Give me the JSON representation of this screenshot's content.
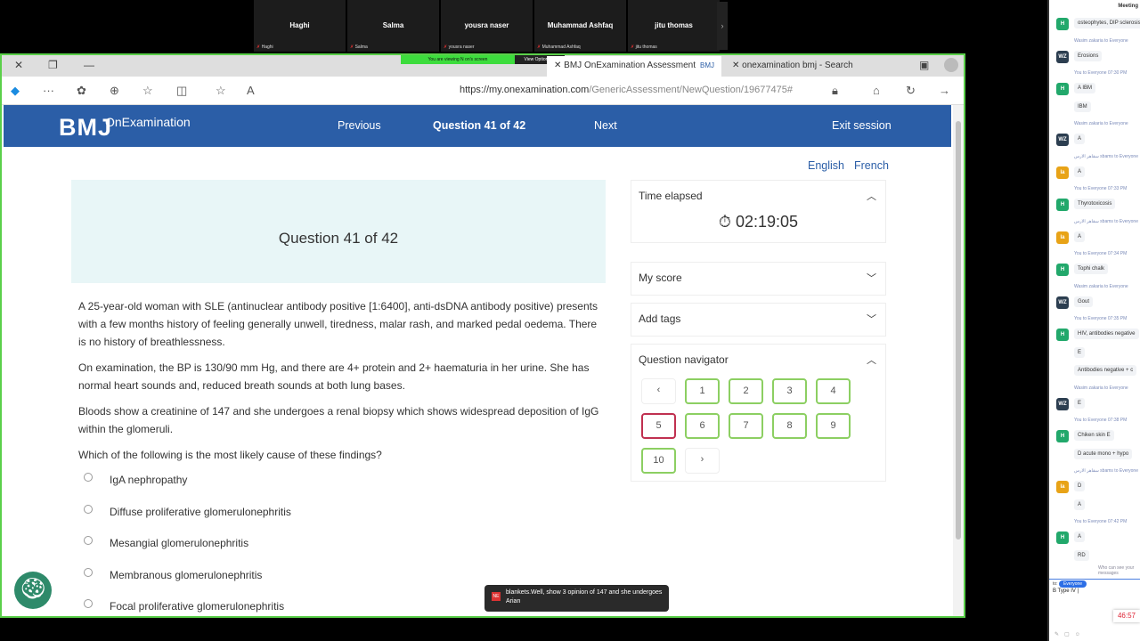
{
  "meeting": {
    "participants": [
      {
        "name": "Haghi",
        "label": "Haghi"
      },
      {
        "name": "Salma",
        "label": "Salma"
      },
      {
        "name": "yousra naser",
        "label": "yousra naser"
      },
      {
        "name": "Muhammad Ashfaq",
        "label": "Muhammad Ashfaq"
      },
      {
        "name": "jitu thomas",
        "label": "jitu thomas"
      }
    ],
    "viewing_banner": "You are viewing N on's screen",
    "view_options": "View Options ⌄"
  },
  "browser": {
    "tabs": [
      {
        "label": "BMJ OnExamination Assessment",
        "badge": "BMJ"
      },
      {
        "label": "onexamination bmj - Search"
      }
    ],
    "url_host": "https://my.onexamination.com",
    "url_path": "/GenericAssessment/NewQuestion/19677475#"
  },
  "header": {
    "logo": "BMJ",
    "product": "OnExamination",
    "previous": "Previous",
    "question_counter": "Question 41 of 42",
    "next": "Next",
    "exit": "Exit session"
  },
  "languages": [
    "English",
    "French"
  ],
  "question": {
    "title": "Question 41 of 42",
    "paragraphs": [
      "A 25-year-old woman with SLE (antinuclear antibody positive [1:6400], anti-dsDNA antibody positive) presents with a few months history of feeling generally unwell, tiredness, malar rash, and marked pedal oedema. There is no history of breathlessness.",
      "On examination, the BP is 130/90 mm Hg, and there are 4+ protein and 2+ haematuria in her urine. She has normal heart sounds and, reduced breath sounds at both lung bases.",
      "Bloods show a creatinine of 147 and she undergoes a renal biopsy which shows widespread deposition of IgG within the glomeruli.",
      "Which of the following is the most likely cause of these findings?"
    ],
    "options": [
      "IgA nephropathy",
      "Diffuse proliferative glomerulonephritis",
      "Mesangial glomerulonephritis",
      "Membranous glomerulonephritis",
      "Focal proliferative glomerulonephritis"
    ]
  },
  "sidebar": {
    "time_label": "Time elapsed",
    "time_value": "02:19:05",
    "score_label": "My score",
    "tags_label": "Add tags",
    "navigator_label": "Question navigator",
    "nav_prev": "‹",
    "nav_next": "›",
    "nav_items": [
      {
        "n": "1",
        "status": "answered"
      },
      {
        "n": "2",
        "status": "answered"
      },
      {
        "n": "3",
        "status": "answered"
      },
      {
        "n": "4",
        "status": "answered"
      },
      {
        "n": "5",
        "status": "incorrect"
      },
      {
        "n": "6",
        "status": "answered"
      },
      {
        "n": "7",
        "status": "answered"
      },
      {
        "n": "8",
        "status": "answered"
      },
      {
        "n": "9",
        "status": "answered"
      },
      {
        "n": "10",
        "status": "answered"
      }
    ]
  },
  "colors": {
    "brand": "#2b5ea7",
    "answered": "#8ccf62",
    "incorrect": "#c03050",
    "question_bg": "#e8f6f7"
  },
  "caption": {
    "avatar": "NE",
    "text": "blankets.Well, show 3 opinion of 147 and she undergoes Arian"
  },
  "chat": {
    "title": "Meeting",
    "items": [
      {
        "t": "msg",
        "av": "H",
        "c": "#22a86b",
        "text": "osteophytes, DIP sclerosis"
      },
      {
        "t": "meta",
        "text": "Wasim zakaria to Everyone"
      },
      {
        "t": "msg",
        "av": "WZ",
        "c": "#2c3e50",
        "text": "Erosions"
      },
      {
        "t": "meta",
        "text": "You to Everyone 07:30 PM"
      },
      {
        "t": "msg",
        "av": "H",
        "c": "#22a86b",
        "text": "A  IBM"
      },
      {
        "t": "bub",
        "text": "IBM"
      },
      {
        "t": "meta",
        "text": "Wasim zakaria to Everyone"
      },
      {
        "t": "msg",
        "av": "WZ",
        "c": "#2c3e50",
        "text": "A"
      },
      {
        "t": "meta",
        "text": "سقاهر الارس sbams to Everyone"
      },
      {
        "t": "msg",
        "av": "la",
        "c": "#e8a317",
        "text": "A"
      },
      {
        "t": "meta",
        "text": "You to Everyone 07:33 PM"
      },
      {
        "t": "msg",
        "av": "H",
        "c": "#22a86b",
        "text": "Thyrotoxicosis"
      },
      {
        "t": "meta",
        "text": "سقاهر الارس sbams to Everyone"
      },
      {
        "t": "msg",
        "av": "la",
        "c": "#e8a317",
        "text": "A"
      },
      {
        "t": "meta",
        "text": "You to Everyone 07:34 PM"
      },
      {
        "t": "msg",
        "av": "H",
        "c": "#22a86b",
        "text": "Tophi chalk"
      },
      {
        "t": "meta",
        "text": "Wasim zakaria to Everyone"
      },
      {
        "t": "msg",
        "av": "WZ",
        "c": "#2c3e50",
        "text": "Gout"
      },
      {
        "t": "meta",
        "text": "You to Everyone 07:35 PM"
      },
      {
        "t": "msg",
        "av": "H",
        "c": "#22a86b",
        "text": "HIV, antibodies negative"
      },
      {
        "t": "bub",
        "text": "E"
      },
      {
        "t": "bub",
        "text": "Antibodies negative + c"
      },
      {
        "t": "meta",
        "text": "Wasim zakaria to Everyone"
      },
      {
        "t": "msg",
        "av": "WZ",
        "c": "#2c3e50",
        "text": "E"
      },
      {
        "t": "meta",
        "text": "You to Everyone 07:38 PM"
      },
      {
        "t": "msg",
        "av": "H",
        "c": "#22a86b",
        "text": "Chiken skin  E"
      },
      {
        "t": "bub",
        "text": "D   acute mono + hypo"
      },
      {
        "t": "meta",
        "text": "سقاهر الارس sbams to Everyone"
      },
      {
        "t": "msg",
        "av": "la",
        "c": "#e8a317",
        "text": "D"
      },
      {
        "t": "bub",
        "text": "A"
      },
      {
        "t": "meta",
        "text": "You to Everyone 07:42 PM"
      },
      {
        "t": "msg",
        "av": "H",
        "c": "#22a86b",
        "text": "A"
      },
      {
        "t": "bub",
        "text": "RD"
      }
    ],
    "who_can_see": "Who can see your messages",
    "to_label": "to:",
    "recipient": "Everyone",
    "draft": "B  Type IV  |",
    "timer": "46:57"
  }
}
